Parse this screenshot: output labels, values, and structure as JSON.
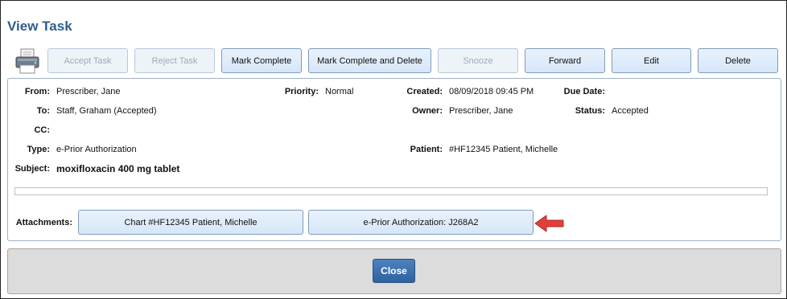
{
  "window": {
    "title": "View Task"
  },
  "toolbar": {
    "print_icon": "printer-icon",
    "buttons": [
      {
        "label": "Accept Task",
        "enabled": false
      },
      {
        "label": "Reject Task",
        "enabled": false
      },
      {
        "label": "Mark Complete",
        "enabled": true
      },
      {
        "label": "Mark Complete and Delete",
        "enabled": true
      },
      {
        "label": "Snooze",
        "enabled": false
      },
      {
        "label": "Forward",
        "enabled": true
      },
      {
        "label": "Edit",
        "enabled": true
      },
      {
        "label": "Delete",
        "enabled": true
      }
    ]
  },
  "task": {
    "from_label": "From:",
    "from": "Prescriber, Jane",
    "to_label": "To:",
    "to": "Staff, Graham (Accepted)",
    "cc_label": "CC:",
    "cc": "",
    "type_label": "Type:",
    "type": "e-Prior Authorization",
    "subject_label": "Subject:",
    "subject": "moxifloxacin 400 mg tablet",
    "priority_label": "Priority:",
    "priority": "Normal",
    "created_label": "Created:",
    "created": "08/09/2018 09:45 PM",
    "owner_label": "Owner:",
    "owner": "Prescriber, Jane",
    "patient_label": "Patient:",
    "patient": "#HF12345 Patient, Michelle",
    "due_date_label": "Due Date:",
    "due_date": "",
    "status_label": "Status:",
    "status": "Accepted"
  },
  "attachments": {
    "label": "Attachments:",
    "items": [
      {
        "label": "Chart #HF12345 Patient, Michelle"
      },
      {
        "label": "e-Prior Authorization: J268A2"
      }
    ]
  },
  "annotation": {
    "arrow_icon": "red-arrow-icon",
    "color": "#e0403a"
  },
  "footer": {
    "close_label": "Close"
  },
  "colors": {
    "title": "#2f5e8c",
    "button_bg": "#dbe8f7",
    "close_bg": "#3a6fae"
  }
}
